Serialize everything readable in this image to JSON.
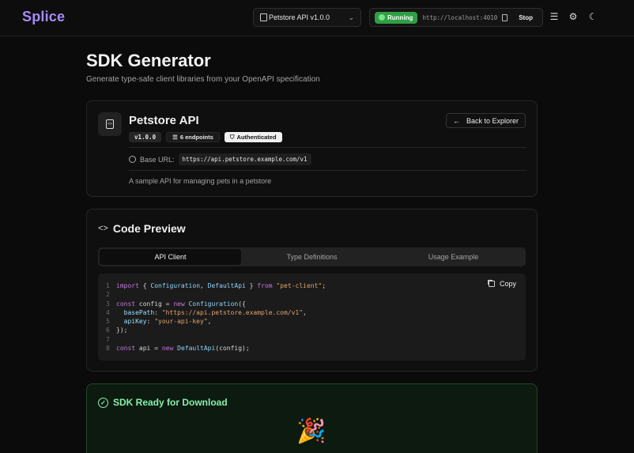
{
  "header": {
    "logo": "Splice",
    "spec_selector": {
      "value": "Petstore API v1.0.0",
      "icon": "file-icon"
    },
    "server": {
      "status": "Running",
      "url": "http://localhost:4010",
      "stop_label": "Stop"
    },
    "icons": [
      "menu-icon",
      "gear-icon",
      "moon-icon"
    ]
  },
  "page": {
    "title": "SDK Generator",
    "subtitle": "Generate type-safe client libraries from your OpenAPI specification"
  },
  "api": {
    "name": "Petstore API",
    "version": "v1.0.0",
    "endpoints": "6 endpoints",
    "auth": "Authenticated",
    "back_label": "Back to Explorer",
    "base_url_label": "Base URL:",
    "base_url": "https://api.petstore.example.com/v1",
    "description": "A sample API for managing pets in a petstore"
  },
  "code_preview": {
    "title": "Code Preview",
    "tabs": [
      "API Client",
      "Type Definitions",
      "Usage Example"
    ],
    "active_tab": "API Client",
    "copy_label": "Copy",
    "line_numbers": [
      "1",
      "2",
      "3",
      "4",
      "5",
      "6",
      "7",
      "8"
    ],
    "code": [
      "import { Configuration, DefaultApi } from \"pet-client\";",
      "",
      "const config = new Configuration({",
      "  basePath: \"https://api.petstore.example.com/v1\",",
      "  apiKey: \"your-api-key\",",
      "});",
      "",
      "const api = new DefaultApi(config);"
    ]
  },
  "sdk_ready": {
    "title": "SDK Ready for Download",
    "emoji": "🎉"
  },
  "colors": {
    "accent": "#a78bfa",
    "running": "#2f9e44",
    "success": "#86efac"
  }
}
